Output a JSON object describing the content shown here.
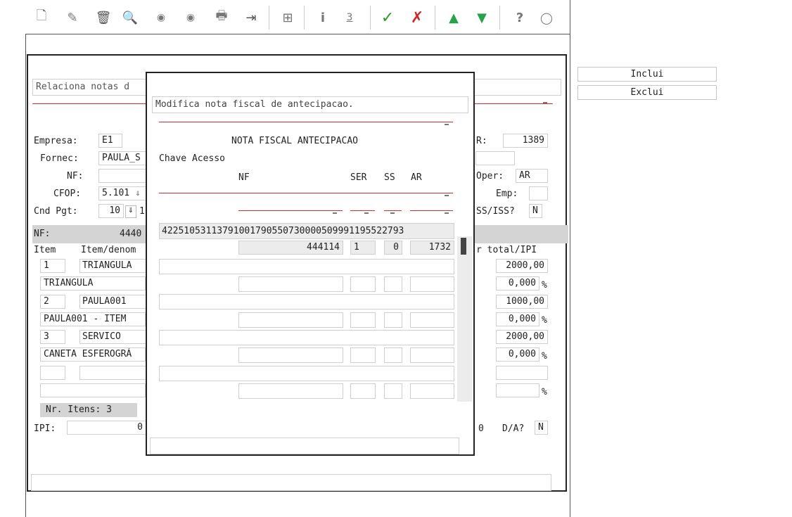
{
  "toolbar": {
    "icons": [
      "new-doc",
      "edit",
      "trash",
      "search",
      "prev",
      "next",
      "print",
      "exit",
      "binoculars",
      "info",
      "numbered",
      "confirm",
      "cancel",
      "up",
      "down",
      "help",
      "comment"
    ],
    "glyphs": {
      "new-doc": "🗋",
      "edit": "✎",
      "trash": "🗑",
      "search": "🔍",
      "prev": "◉",
      "next": "◉",
      "print": "🖶",
      "exit": "⇥",
      "binoculars": "⊞",
      "info": "i",
      "numbered": "3",
      "confirm": "✓",
      "cancel": "✗",
      "up": "▲",
      "down": "▼",
      "help": "?",
      "comment": "◯"
    },
    "colors": {
      "confirm": "#2a9a2a",
      "cancel": "#d42424",
      "up": "#27a24a",
      "down": "#27a24a"
    }
  },
  "side_buttons": {
    "inclui": "Inclui",
    "exclui": "Exclui"
  },
  "main": {
    "title": "Relaciona notas d",
    "empresa_label": "Empresa:",
    "empresa_value": "E1",
    "fornec_label": "Fornec:",
    "fornec_value": "PAULA_S",
    "nf_label": "NF:",
    "cfop_label": "CFOP:",
    "cfop_value": "5.101",
    "cnd_label": "Cnd Pgt:",
    "cnd_value": "10",
    "cnd_value2": "1",
    "nf_bar_label": "NF:",
    "nf_bar_value": "4440",
    "item_header": "Item",
    "item_denom_header": "Item/denom",
    "r_label": "R:",
    "r_value": "1389",
    "oper_label": "Oper:",
    "oper_value": "AR",
    "emp_label": "Emp:",
    "ss_iss_label": "SS/ISS?",
    "ss_iss_value": "N",
    "total_ipi_header": "r total/IPI",
    "items": [
      {
        "num": "1",
        "code": "TRIANGULA",
        "desc": "TRIANGULA",
        "total": "2000,00",
        "ipi": "0,000"
      },
      {
        "num": "2",
        "code": "PAULA001",
        "desc": "PAULA001 - ITEM",
        "total": "1000,00",
        "ipi": "0,000"
      },
      {
        "num": "3",
        "code": "SERVICO",
        "desc": "CANETA ESFEROGRÁ",
        "total": "2000,00",
        "ipi": "0,000"
      }
    ],
    "percent": "%",
    "nr_itens": "Nr. Itens: 3",
    "ipi_label": "IPI:",
    "ipi_value": "0",
    "right_small": "0",
    "da_label": "D/A?",
    "da_value": "N"
  },
  "modal": {
    "title": "Modifica nota fiscal de antecipacao.",
    "heading": "NOTA FISCAL ANTECIPACAO",
    "chave_label": "Chave Acesso",
    "col_nf": "NF",
    "col_ser": "SER",
    "col_ss": "SS",
    "col_ar": "AR",
    "chave_value": "42251053113791001790550730000509991195522793",
    "row": {
      "nf": "444114",
      "ser": "1",
      "ss": "0",
      "ar": "1732"
    }
  }
}
